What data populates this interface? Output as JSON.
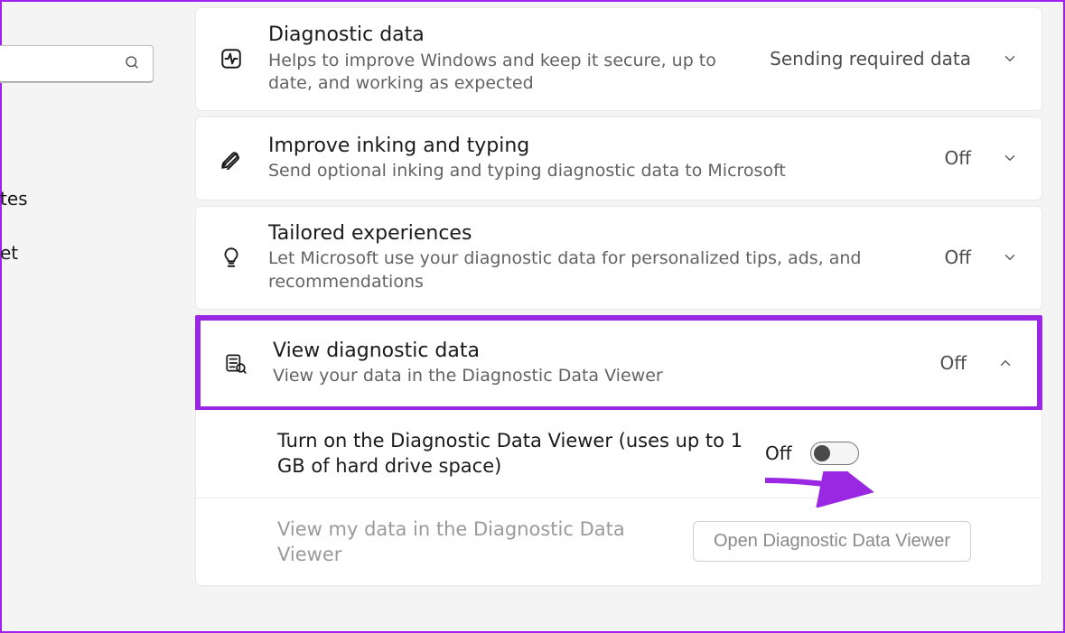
{
  "sidebar": {
    "search_placeholder": "",
    "nav_fragments": [
      "tes",
      "et"
    ]
  },
  "rows": [
    {
      "icon": "activity",
      "title": "Diagnostic data",
      "sub": "Helps to improve Windows and keep it secure, up to date, and working as expected",
      "status": "Sending required data",
      "chev": "down"
    },
    {
      "icon": "pen",
      "title": "Improve inking and typing",
      "sub": "Send optional inking and typing diagnostic data to Microsoft",
      "status": "Off",
      "chev": "down"
    },
    {
      "icon": "bulb",
      "title": "Tailored experiences",
      "sub": "Let Microsoft use your diagnostic data for personalized tips, ads, and recommendations",
      "status": "Off",
      "chev": "down"
    },
    {
      "icon": "viewer",
      "title": "View diagnostic data",
      "sub": "View your data in the Diagnostic Data Viewer",
      "status": "Off",
      "chev": "up",
      "highlighted": true
    }
  ],
  "expanded": {
    "toggle_label": "Turn on the Diagnostic Data Viewer (uses up to 1 GB of hard drive space)",
    "toggle_state": "Off",
    "view_label": "View my data in the Diagnostic Data Viewer",
    "open_button": "Open Diagnostic Data Viewer"
  }
}
